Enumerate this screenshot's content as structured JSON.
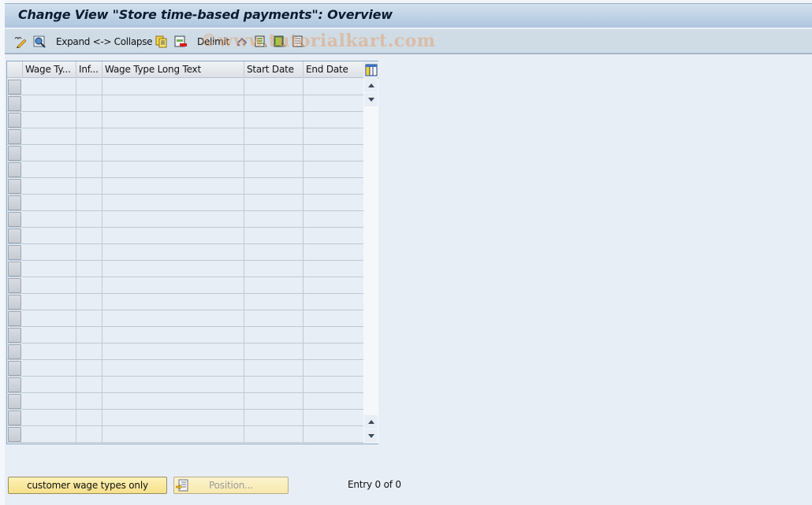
{
  "window": {
    "title": "Change View \"Store time-based payments\": Overview"
  },
  "toolbar": {
    "items": [
      {
        "id": "change-display",
        "icon": "pencil-glasses-icon"
      },
      {
        "id": "details",
        "icon": "magnifier-detail-icon"
      },
      {
        "id": "expand-collapse",
        "label": "Expand <-> Collapse"
      },
      {
        "id": "copy-as",
        "icon": "copy-icon"
      },
      {
        "id": "delete",
        "icon": "delete-row-icon"
      },
      {
        "id": "delimit",
        "label": "Delimit"
      },
      {
        "id": "undo-change",
        "icon": "undo-icon"
      },
      {
        "id": "select-all",
        "icon": "select-all-icon"
      },
      {
        "id": "select-block",
        "icon": "select-block-icon"
      },
      {
        "id": "deselect-all",
        "icon": "deselect-all-icon"
      }
    ],
    "expand_label": "Expand <-> Collapse",
    "delimit_label": "Delimit",
    "watermark": "©www.tutorialkart.com"
  },
  "table": {
    "columns": [
      {
        "key": "wage_type",
        "label": "Wage Ty..."
      },
      {
        "key": "infotype",
        "label": "Inf..."
      },
      {
        "key": "long_text",
        "label": "Wage Type Long Text"
      },
      {
        "key": "start_date",
        "label": "Start Date"
      },
      {
        "key": "end_date",
        "label": "End Date"
      }
    ],
    "rows": [],
    "visible_empty_rows": 22,
    "config_icon": "table-settings-icon"
  },
  "footer": {
    "customer_button": "customer wage types only",
    "position_button": "Position...",
    "entry_text": "Entry 0 of 0"
  },
  "colors": {
    "title_bar": "#aec6df",
    "toolbar": "#cfdce6",
    "background": "#e8eef6",
    "button_yellow": "#f6e08a"
  }
}
